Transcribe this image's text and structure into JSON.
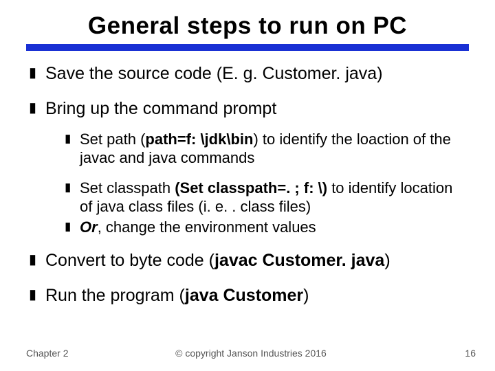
{
  "title": "General steps to run on PC",
  "bullets": {
    "b1": "Save the source code (E. g. Customer. java)",
    "b2": "Bring up the command prompt",
    "b2_sub1_pre": "Set path (",
    "b2_sub1_bold": "path=f: \\jdk\\bin",
    "b2_sub1_post": ") to identify the loaction of the javac and java commands",
    "b2_sub2_pre": "Set classpath ",
    "b2_sub2_bold": "(Set classpath=. ; f: \\)",
    "b2_sub2_post": " to identify location of java class files (i. e. . class files)",
    "b2_sub3_pre": "Or",
    "b2_sub3_post": ", change the environment values",
    "b3_pre": "Convert to byte code (",
    "b3_bold": "javac  Customer. java",
    "b3_post": ")",
    "b4_pre": "Run the program (",
    "b4_bold": "java  Customer",
    "b4_post": ")"
  },
  "footer": {
    "chapter": "Chapter 2",
    "copyright": "© copyright Janson Industries 2016",
    "page": "16"
  }
}
